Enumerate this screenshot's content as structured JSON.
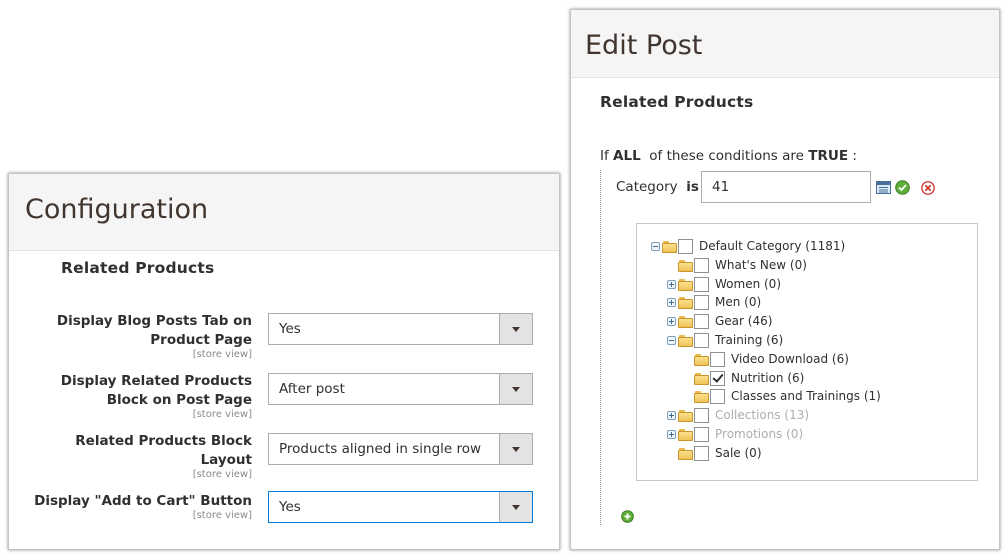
{
  "config": {
    "title": "Configuration",
    "section_title": "Related Products",
    "rows": [
      {
        "label_lines": [
          "Display Blog Posts Tab on",
          "Product Page"
        ],
        "scope": "[store view]",
        "value": "Yes"
      },
      {
        "label_lines": [
          "Display Related Products",
          "Block on Post Page"
        ],
        "scope": "[store view]",
        "value": "After post"
      },
      {
        "label_lines": [
          "Related Products Block",
          "Layout"
        ],
        "scope": "[store view]",
        "value": "Products aligned in single row"
      },
      {
        "label_lines": [
          "Display \"Add to Cart\" Button"
        ],
        "scope": "[store view]",
        "value": "Yes"
      }
    ]
  },
  "edit": {
    "title": "Edit Post",
    "section_title": "Related Products",
    "condition": {
      "prefix": "If",
      "aggregator": "ALL",
      "middle": "of these conditions are",
      "value": "TRUE",
      "suffix": ":"
    },
    "rule": {
      "attribute": "Category",
      "operator": "is",
      "value": "41"
    },
    "tree": [
      {
        "label": "Default Category (1181)",
        "checked": false,
        "muted": false,
        "expander": "minus"
      },
      {
        "label": "What's New (0)",
        "checked": false,
        "muted": false,
        "expander": "none"
      },
      {
        "label": "Women (0)",
        "checked": false,
        "muted": false,
        "expander": "plus"
      },
      {
        "label": "Men (0)",
        "checked": false,
        "muted": false,
        "expander": "plus"
      },
      {
        "label": "Gear (46)",
        "checked": false,
        "muted": false,
        "expander": "plus"
      },
      {
        "label": "Training (6)",
        "checked": false,
        "muted": false,
        "expander": "minus"
      },
      {
        "label": "Video Download (6)",
        "checked": false,
        "muted": false,
        "expander": "none"
      },
      {
        "label": "Nutrition (6)",
        "checked": true,
        "muted": false,
        "expander": "none"
      },
      {
        "label": "Classes and Trainings (1)",
        "checked": false,
        "muted": false,
        "expander": "none"
      },
      {
        "label": "Collections (13)",
        "checked": false,
        "muted": true,
        "expander": "plus"
      },
      {
        "label": "Promotions (0)",
        "checked": false,
        "muted": true,
        "expander": "plus"
      },
      {
        "label": "Sale (0)",
        "checked": false,
        "muted": false,
        "expander": "none"
      }
    ]
  }
}
